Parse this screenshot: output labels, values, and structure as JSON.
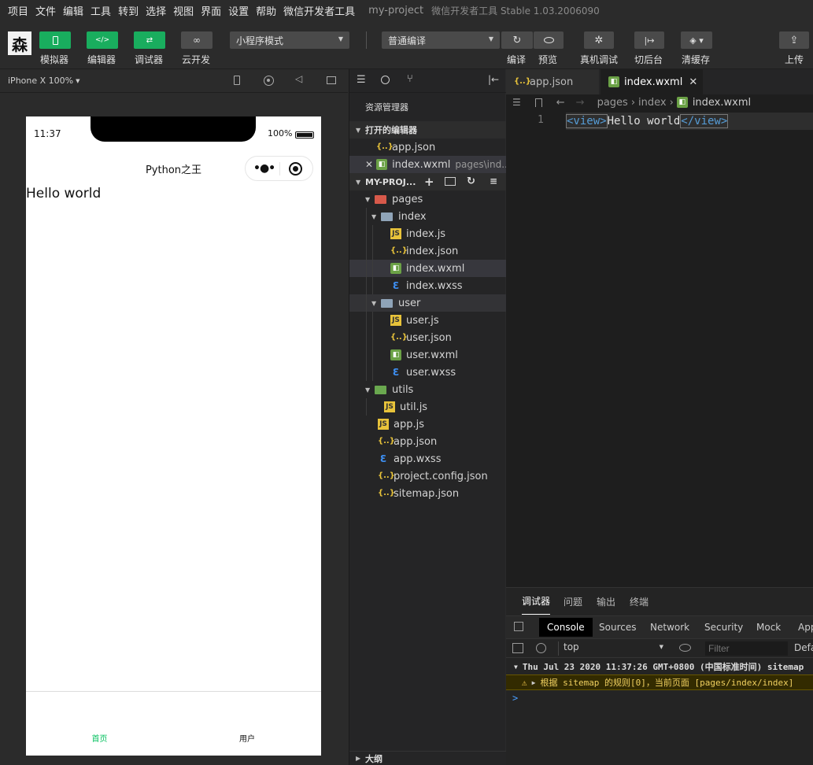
{
  "menubar": {
    "items": [
      "项目",
      "文件",
      "编辑",
      "工具",
      "转到",
      "选择",
      "视图",
      "界面",
      "设置",
      "帮助",
      "微信开发者工具"
    ],
    "project": "my-project",
    "app_version": "微信开发者工具 Stable 1.03.2006090"
  },
  "toolbar": {
    "avatar_char": "森",
    "simulator": "模拟器",
    "editor": "编辑器",
    "debugger": "调试器",
    "cloud": "云开发",
    "mode_select": "小程序模式",
    "compile_select": "普通编译",
    "compile": "编译",
    "preview": "预览",
    "real_debug": "真机调试",
    "background": "切后台",
    "clear_cache": "清缓存",
    "upload": "上传"
  },
  "simulator": {
    "device": "iPhone X 100%",
    "time": "11:37",
    "battery": "100%",
    "nav_title": "Python之王",
    "page_text": "Hello world",
    "tab_home": "首页",
    "tab_user": "用户",
    "colors": {
      "tab_active": "#07c160"
    }
  },
  "explorer": {
    "title": "资源管理器",
    "open_editors": "打开的编辑器",
    "open_files": [
      {
        "name": "app.json",
        "icon": "json",
        "path": ""
      },
      {
        "name": "index.wxml",
        "icon": "wxml",
        "path": "pages\\ind..."
      }
    ],
    "project_section": "MY-PROJ...",
    "tree": [
      {
        "name": "pages",
        "icon": "folder-red",
        "depth": 0,
        "arrow": "▼"
      },
      {
        "name": "index",
        "icon": "folder",
        "depth": 1,
        "arrow": "▼"
      },
      {
        "name": "index.js",
        "icon": "js",
        "depth": 2
      },
      {
        "name": "index.json",
        "icon": "json",
        "depth": 2
      },
      {
        "name": "index.wxml",
        "icon": "wxml",
        "depth": 2,
        "selected": true
      },
      {
        "name": "index.wxss",
        "icon": "wxss",
        "depth": 2
      },
      {
        "name": "user",
        "icon": "folder",
        "depth": 1,
        "arrow": "▼",
        "hover": true
      },
      {
        "name": "user.js",
        "icon": "js",
        "depth": 2
      },
      {
        "name": "user.json",
        "icon": "json",
        "depth": 2
      },
      {
        "name": "user.wxml",
        "icon": "wxml",
        "depth": 2
      },
      {
        "name": "user.wxss",
        "icon": "wxss",
        "depth": 2
      },
      {
        "name": "utils",
        "icon": "folder-green",
        "depth": 0,
        "arrow": "▼"
      },
      {
        "name": "util.js",
        "icon": "js",
        "depth": 1
      },
      {
        "name": "app.js",
        "icon": "js",
        "depth": 0,
        "file": true
      },
      {
        "name": "app.json",
        "icon": "json",
        "depth": 0,
        "file": true
      },
      {
        "name": "app.wxss",
        "icon": "wxss",
        "depth": 0,
        "file": true
      },
      {
        "name": "project.config.json",
        "icon": "json",
        "depth": 0,
        "file": true
      },
      {
        "name": "sitemap.json",
        "icon": "json",
        "depth": 0,
        "file": true
      }
    ],
    "outline": "大纲"
  },
  "editor": {
    "tabs": [
      {
        "name": "app.json",
        "icon": "json",
        "active": false
      },
      {
        "name": "index.wxml",
        "icon": "wxml",
        "active": true
      }
    ],
    "breadcrumb": [
      "pages",
      "index",
      "index.wxml"
    ],
    "line_number": "1",
    "code": {
      "open_tag": "<view>",
      "text": "Hello world",
      "close_tag": "</view>"
    }
  },
  "debug": {
    "tabs": [
      "调试器",
      "问题",
      "输出",
      "终端"
    ],
    "console_tabs": [
      "Console",
      "Sources",
      "Network",
      "Security",
      "Mock",
      "App"
    ],
    "context": "top",
    "filter_placeholder": "Filter",
    "levels": "Defa",
    "log_time": "Thu Jul 23 2020 11:37:26 GMT+0800 (中国标准时间) sitemap",
    "log_warning": "根据 sitemap 的规则[0]，当前页面 [pages/index/index]",
    "prompt": ">"
  }
}
